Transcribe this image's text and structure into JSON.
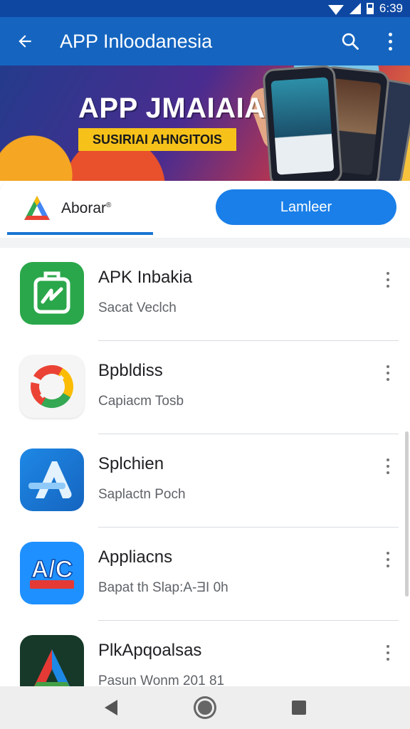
{
  "status_bar": {
    "time": "6:39",
    "icons": [
      "wifi-icon",
      "signal-icon",
      "battery-icon"
    ]
  },
  "app_bar": {
    "title": "APP Inloodanesia",
    "back_icon": "arrow-left-icon",
    "search_icon": "search-icon",
    "more_icon": "more-vert-icon"
  },
  "banner": {
    "title": "APP JMAIAIA",
    "subtitle": "SUSIRIAI AHNGITOIS"
  },
  "tabs": {
    "active_label": "Aborar",
    "active_superscript": "®",
    "button_label": "Lamleer"
  },
  "list": {
    "items": [
      {
        "title": "APK Inbakia",
        "subtitle": "Sacat Veclch",
        "icon": "green-box-app-icon"
      },
      {
        "title": "Bpbldiss",
        "subtitle": "Capiacm Tosb",
        "icon": "google-ring-app-icon"
      },
      {
        "title": "Splchien",
        "subtitle": "Saplactn Poch",
        "icon": "blue-a-app-icon"
      },
      {
        "title": "Appliacns",
        "subtitle": "Bapat th Slap:A-ƎI 0h",
        "icon": "ajc-app-icon"
      },
      {
        "title": "PlkApqoalsas",
        "subtitle": "Pasun Wonm 201 81",
        "icon": "dark-triangle-app-icon"
      }
    ]
  },
  "colors": {
    "app_bar": "#1565c0",
    "status_bar": "#0d47a1",
    "accent": "#1a7fe8"
  },
  "nav": {
    "back_icon": "nav-back-icon",
    "home_icon": "nav-home-icon",
    "recent_icon": "nav-recent-icon"
  }
}
